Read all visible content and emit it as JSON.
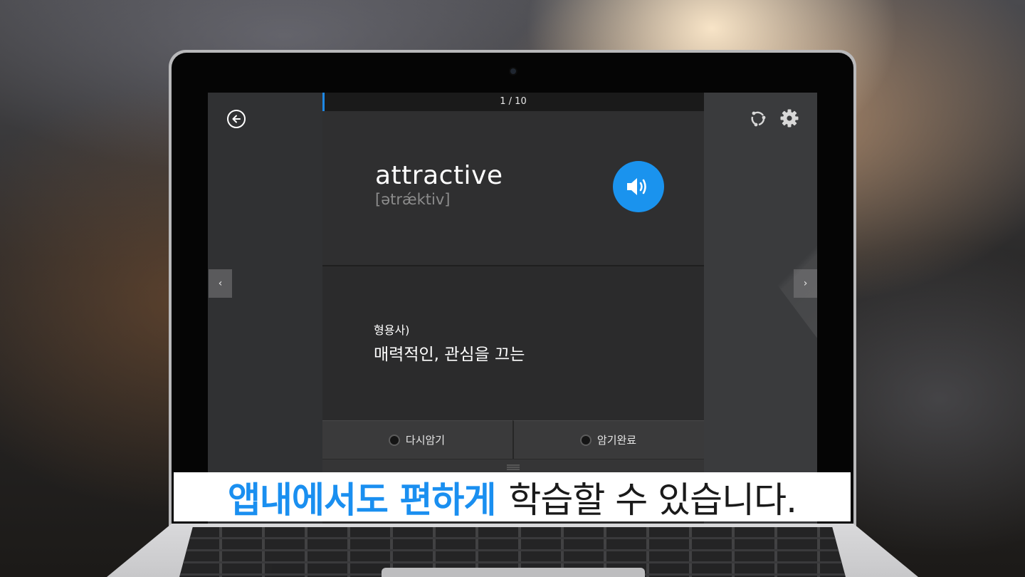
{
  "app": {
    "progress": {
      "text": "1 / 10",
      "fraction": 0.004
    },
    "card": {
      "word": "attractive",
      "pronunciation": "[ətrǽktiv]",
      "part_of_speech": "형용사)",
      "meaning": "매력적인, 관심을 끄는"
    },
    "actions": {
      "review_again_label": "다시암기",
      "memorized_label": "암기완료"
    },
    "icons": {
      "back": "back-arrow-icon",
      "share": "share-icon",
      "settings": "gear-icon",
      "speaker": "speaker-icon",
      "prev": "chevron-left-icon",
      "next": "chevron-right-icon",
      "handle": "drag-handle-icon"
    },
    "nav": {
      "prev_label": "‹",
      "next_label": "›"
    }
  },
  "caption": {
    "highlight": "앱내에서도 편하게",
    "rest": "학습할 수 있습니다."
  },
  "colors": {
    "accent": "#1a93ee",
    "caption_highlight": "#1a8ff0"
  }
}
